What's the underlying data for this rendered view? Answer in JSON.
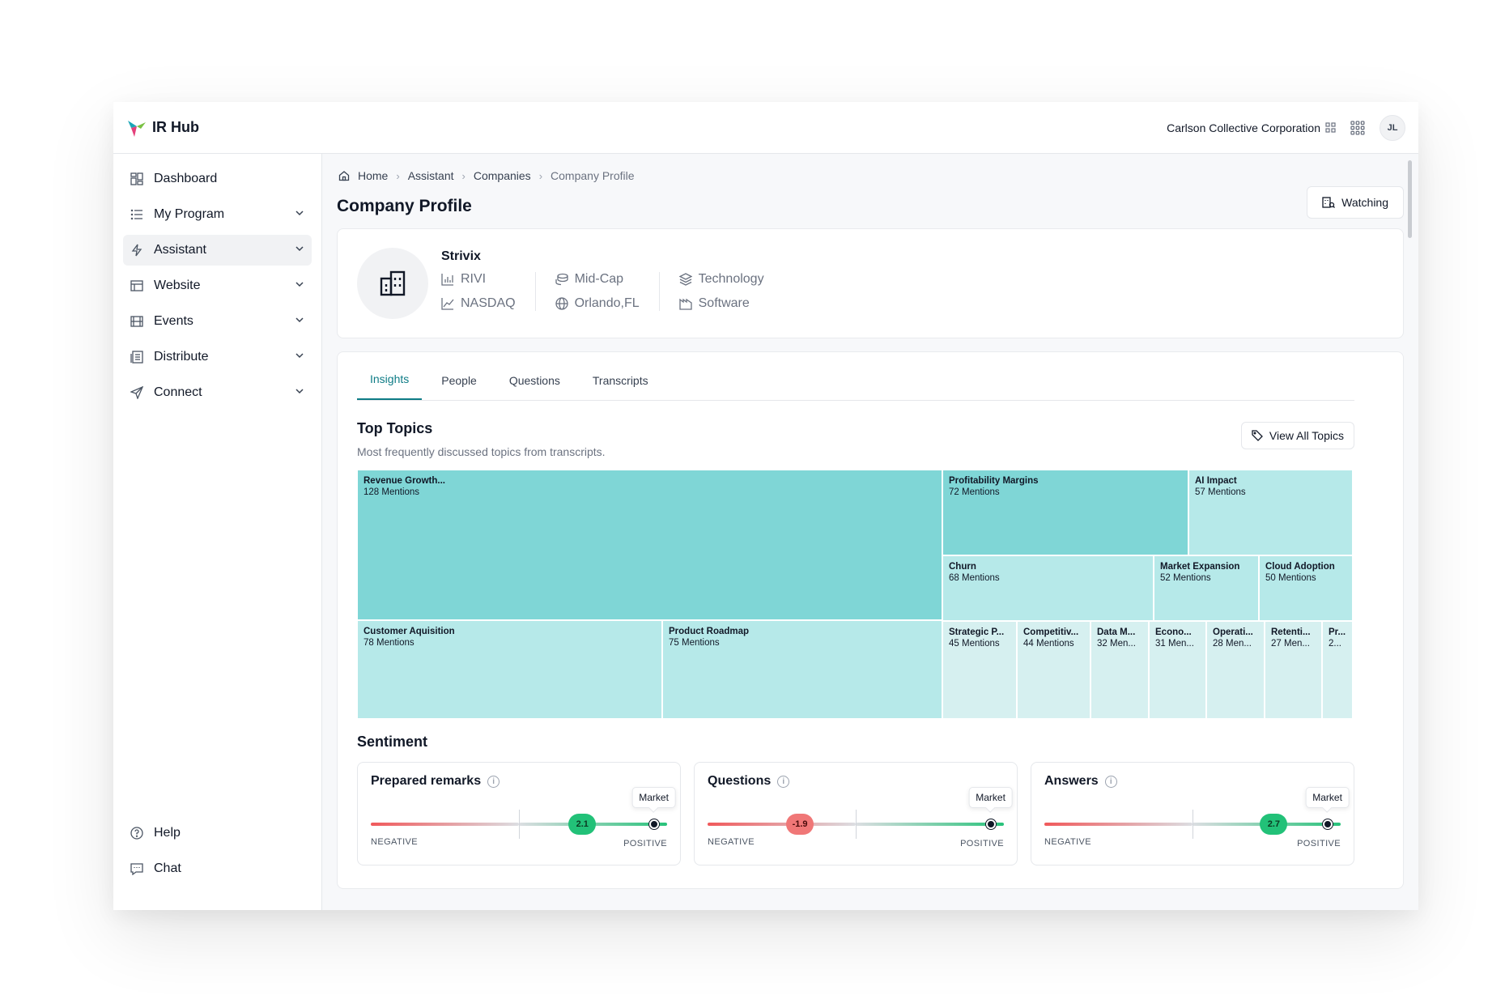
{
  "app": {
    "title": "IR Hub"
  },
  "header": {
    "org_name": "Carlson Collective Corporation",
    "avatar_initials": "JL"
  },
  "sidebar": {
    "items": [
      {
        "label": "Dashboard",
        "icon": "dashboard-icon"
      },
      {
        "label": "My Program",
        "icon": "list-icon"
      },
      {
        "label": "Assistant",
        "icon": "bolt-icon"
      },
      {
        "label": "Website",
        "icon": "layout-icon"
      },
      {
        "label": "Events",
        "icon": "film-icon"
      },
      {
        "label": "Distribute",
        "icon": "newspaper-icon"
      },
      {
        "label": "Connect",
        "icon": "send-icon"
      }
    ],
    "bottom": [
      {
        "label": "Help",
        "icon": "help-icon"
      },
      {
        "label": "Chat",
        "icon": "chat-icon"
      }
    ]
  },
  "breadcrumb": [
    "Home",
    "Assistant",
    "Companies",
    "Company Profile"
  ],
  "page": {
    "title": "Company Profile",
    "watch_label": "Watching"
  },
  "company": {
    "name": "Strivix",
    "ticker": "RIVI",
    "exchange": "NASDAQ",
    "cap": "Mid-Cap",
    "location": "Orlando,FL",
    "sector": "Technology",
    "industry": "Software"
  },
  "tabs": [
    "Insights",
    "People",
    "Questions",
    "Transcripts"
  ],
  "top_topics": {
    "title": "Top Topics",
    "subtitle": "Most frequently discussed topics from transcripts.",
    "view_all": "View All Topics",
    "colors": {
      "dark": "#7fd6d6",
      "mid": "#b6e9e9",
      "light": "#d6f0f0"
    },
    "items": [
      {
        "name": "Revenue Growth...",
        "count": "128 Mentions"
      },
      {
        "name": "Profitability Margins",
        "count": "72 Mentions"
      },
      {
        "name": "AI Impact",
        "count": "57 Mentions"
      },
      {
        "name": "Churn",
        "count": "68 Mentions"
      },
      {
        "name": "Market Expansion",
        "count": "52 Mentions"
      },
      {
        "name": "Cloud Adoption",
        "count": "50 Mentions"
      },
      {
        "name": "Customer Aquisition",
        "count": "78 Mentions"
      },
      {
        "name": "Product Roadmap",
        "count": "75 Mentions"
      },
      {
        "name": "Strategic P...",
        "count": "45 Mentions"
      },
      {
        "name": "Competitiv...",
        "count": "44 Mentions"
      },
      {
        "name": "Data M...",
        "count": "32 Men..."
      },
      {
        "name": "Econo...",
        "count": "31 Men..."
      },
      {
        "name": "Operati...",
        "count": "28 Men..."
      },
      {
        "name": "Retenti...",
        "count": "27 Men..."
      },
      {
        "name": "Pr...",
        "count": "2..."
      }
    ]
  },
  "sentiment": {
    "title": "Sentiment",
    "negative_label": "NEGATIVE",
    "positive_label": "POSITIVE",
    "market_label": "Market",
    "cards": [
      {
        "title": "Prepared remarks",
        "score": "2.1",
        "score_value": 2.1,
        "market_value": 4.5
      },
      {
        "title": "Questions",
        "score": "-1.9",
        "score_value": -1.9,
        "market_value": 4.5
      },
      {
        "title": "Answers",
        "score": "2.7",
        "score_value": 2.7,
        "market_value": 4.5
      }
    ]
  }
}
